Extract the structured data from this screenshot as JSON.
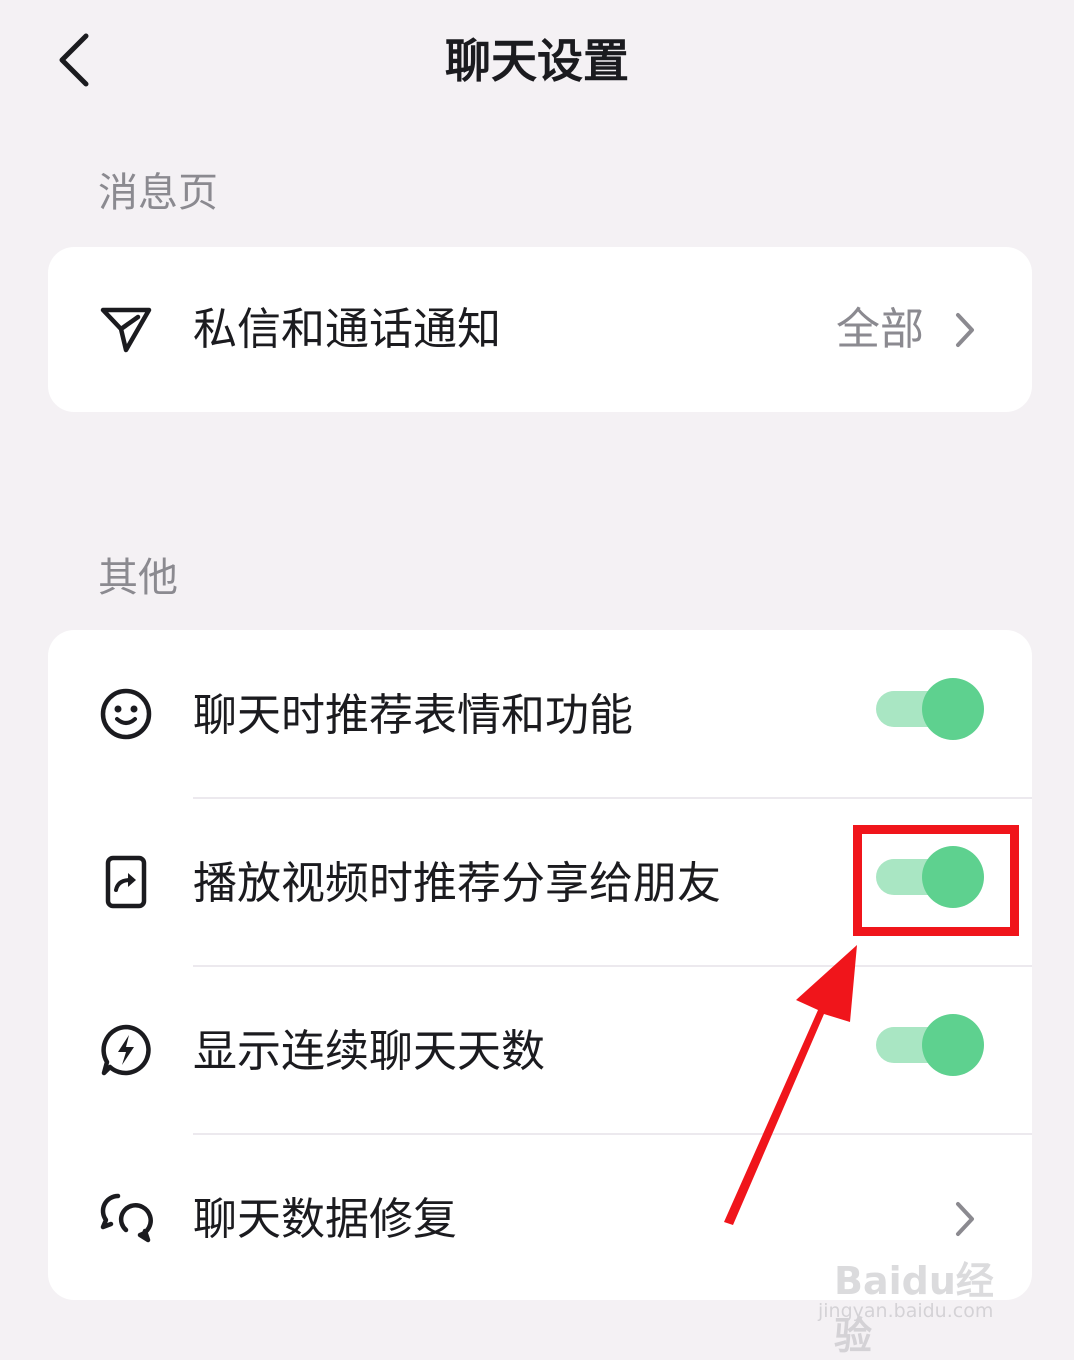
{
  "header": {
    "title": "聊天设置"
  },
  "sections": [
    {
      "label": "消息页",
      "items": [
        {
          "label": "私信和通话通知",
          "value": "全部",
          "icon": "send-icon",
          "control": "chevron"
        }
      ]
    },
    {
      "label": "其他",
      "items": [
        {
          "label": "聊天时推荐表情和功能",
          "icon": "smile-face-icon",
          "control": "toggle",
          "on": true
        },
        {
          "label": "播放视频时推荐分享给朋友",
          "icon": "share-video-icon",
          "control": "toggle",
          "on": true
        },
        {
          "label": "显示连续聊天天数",
          "icon": "lightning-chat-icon",
          "control": "toggle",
          "on": true
        },
        {
          "label": "聊天数据修复",
          "icon": "chat-repair-icon",
          "control": "chevron"
        }
      ]
    }
  ],
  "watermark": {
    "brand": "Baidu经验",
    "url": "jingyan.baidu.com"
  },
  "colors": {
    "background": "#f4f1f4",
    "card": "#ffffff",
    "toggle_knob": "#5ed18f",
    "toggle_track": "#a9e6c3",
    "highlight": "#f0151b",
    "secondary_text": "#8b8a90"
  }
}
